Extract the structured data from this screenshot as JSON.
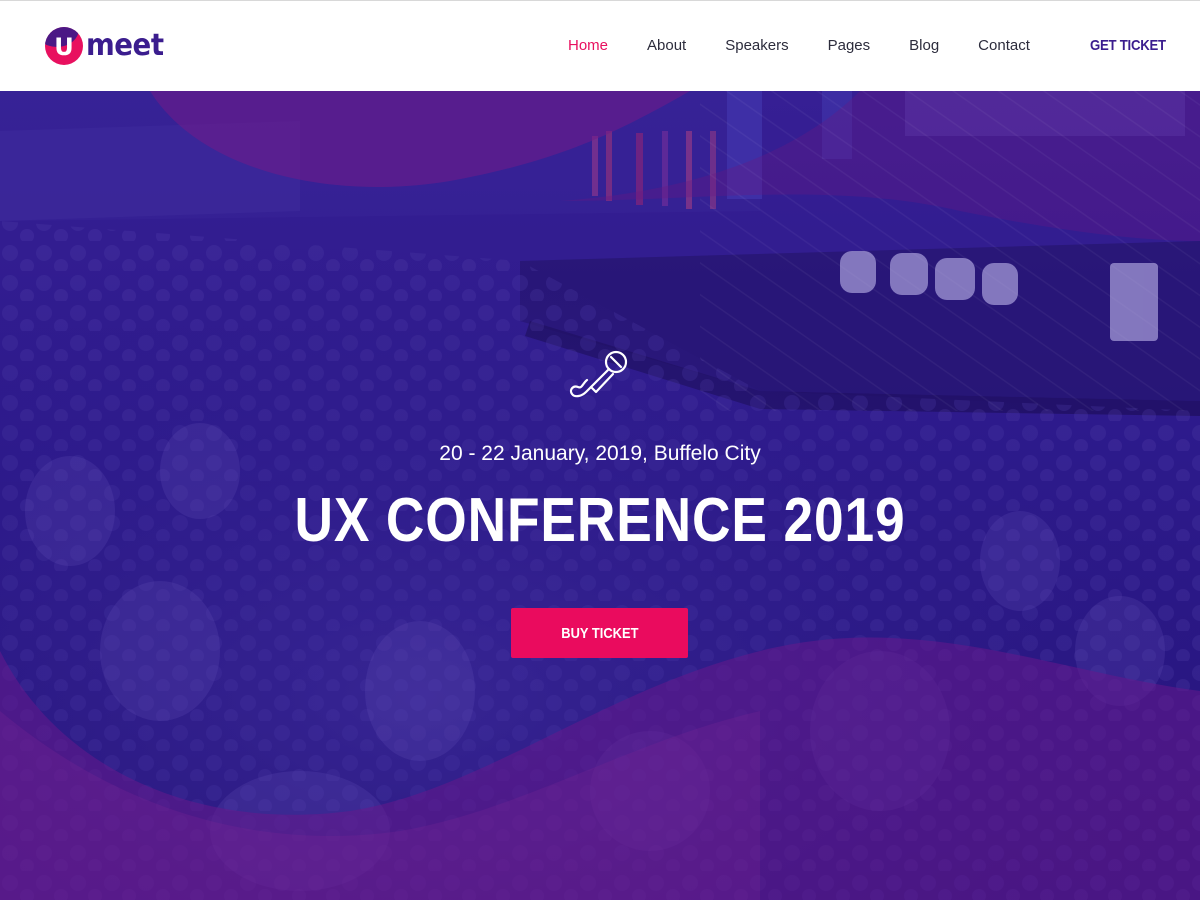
{
  "brand": {
    "logo_letter": "U",
    "logo_text": "meet",
    "colors": {
      "primary": "#3b1d8e",
      "accent": "#e8105f"
    }
  },
  "nav": {
    "items": [
      {
        "label": "Home",
        "active": true
      },
      {
        "label": "About",
        "active": false
      },
      {
        "label": "Speakers",
        "active": false
      },
      {
        "label": "Pages",
        "active": false
      },
      {
        "label": "Blog",
        "active": false
      },
      {
        "label": "Contact",
        "active": false
      }
    ],
    "cta_label": "GET TICKET"
  },
  "hero": {
    "icon": "microphone-icon",
    "date_location": "20 - 22 January, 2019, Buffelo City",
    "title": "UX CONFERENCE 2019",
    "button_label": "BUY TICKET",
    "overlay_color": "#2f1a8f",
    "wave_color": "#6a1a86"
  }
}
